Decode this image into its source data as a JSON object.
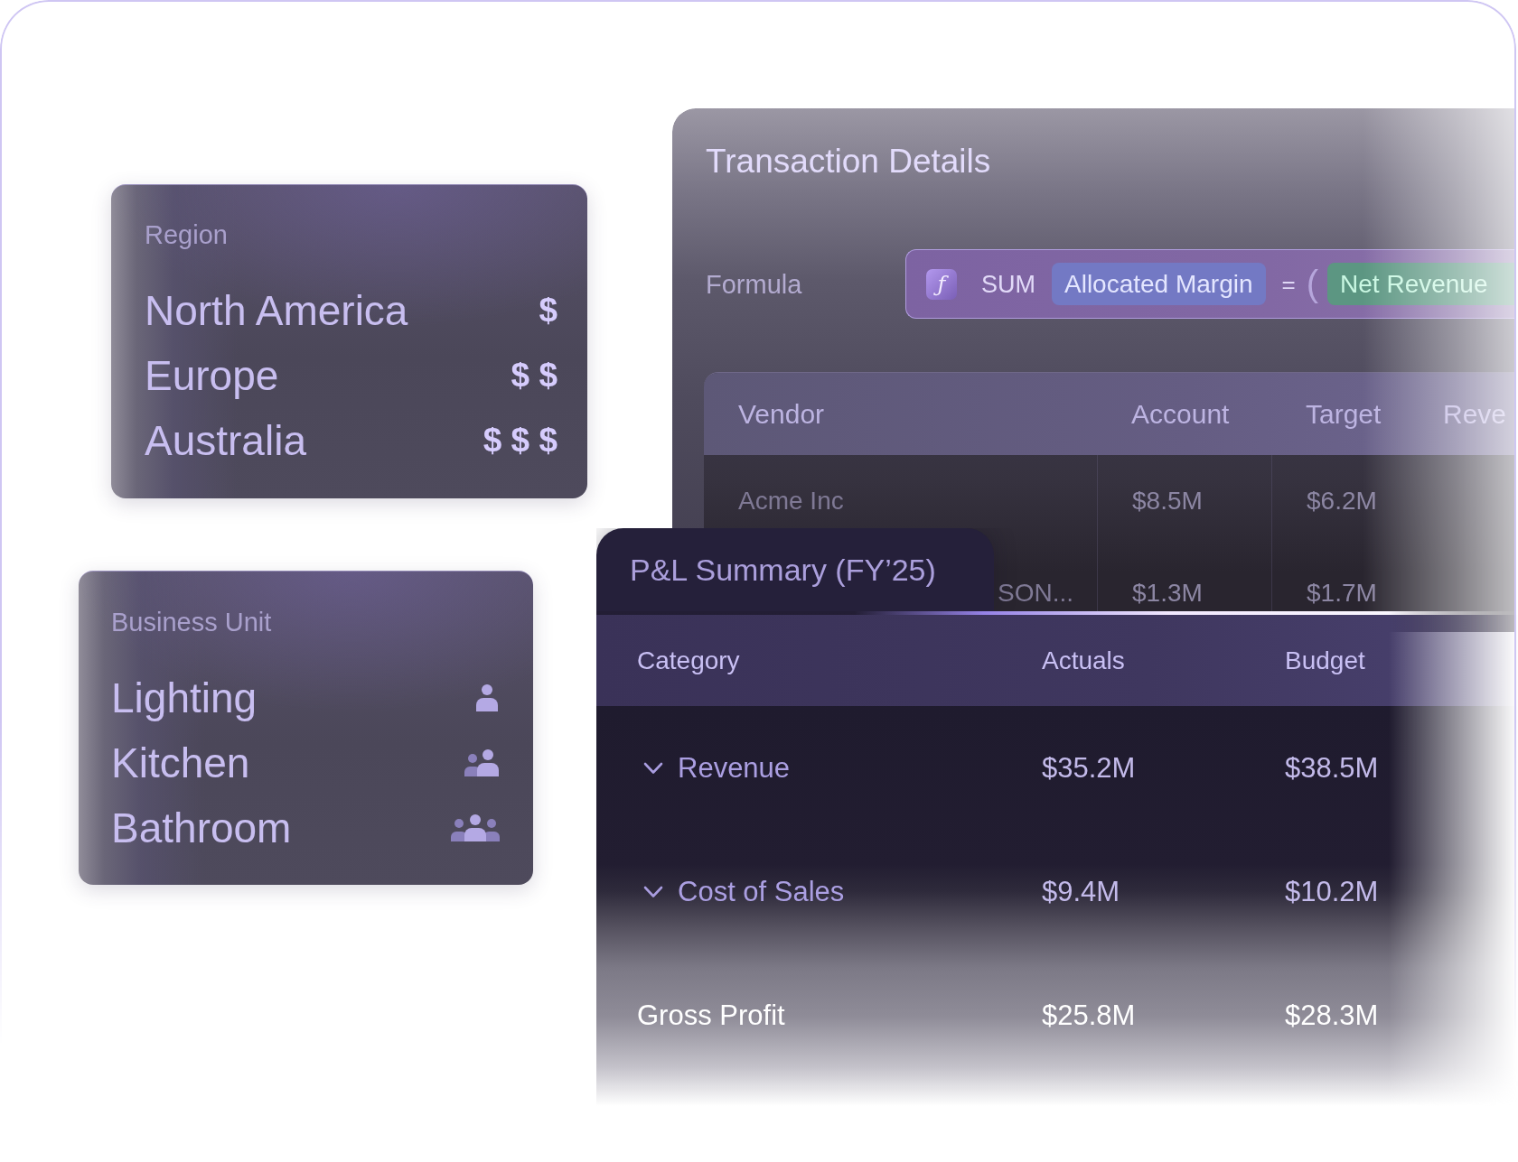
{
  "region_card": {
    "label": "Region",
    "items": [
      {
        "name": "North America",
        "tier": "$"
      },
      {
        "name": "Europe",
        "tier": "$ $"
      },
      {
        "name": "Australia",
        "tier": "$ $ $"
      }
    ]
  },
  "business_unit_card": {
    "label": "Business Unit",
    "items": [
      {
        "name": "Lighting",
        "kind": "person"
      },
      {
        "name": "Kitchen",
        "kind": "pair"
      },
      {
        "name": "Bathroom",
        "kind": "team"
      }
    ]
  },
  "transaction_details": {
    "title": "Transaction Details",
    "formula": {
      "label": "Formula",
      "icon": "ƒ",
      "tokens": [
        {
          "kind": "function",
          "text": "SUM"
        },
        {
          "kind": "field",
          "text": "Allocated Margin",
          "color": "#7379c4"
        },
        {
          "kind": "operator",
          "text": "="
        },
        {
          "kind": "paren",
          "text": "("
        },
        {
          "kind": "field",
          "text": "Net Revenue",
          "color": "#5c9682"
        }
      ]
    },
    "table": {
      "columns": [
        "Vendor",
        "Account",
        "Target",
        "Reve"
      ],
      "rows": [
        {
          "cells": [
            "Acme Inc",
            "$8.5M",
            "$6.2M"
          ],
          "covered": false
        },
        {
          "cells": [
            "SON...",
            "$1.3M",
            "$1.7M"
          ],
          "covered": true
        }
      ]
    }
  },
  "pl_summary": {
    "title": "P&L Summary (FY’25)",
    "columns": [
      "Category",
      "Actuals",
      "Budget"
    ],
    "rows": [
      {
        "kind": "group",
        "expanded": true,
        "label": "Revenue",
        "actuals": "$35.2M",
        "budget": "$38.5M"
      },
      {
        "kind": "group",
        "expanded": true,
        "label": "Cost of Sales",
        "actuals": "$9.4M",
        "budget": "$10.2M"
      },
      {
        "kind": "total",
        "label": "Gross Profit",
        "actuals": "$25.8M",
        "budget": "$28.3M"
      }
    ]
  }
}
